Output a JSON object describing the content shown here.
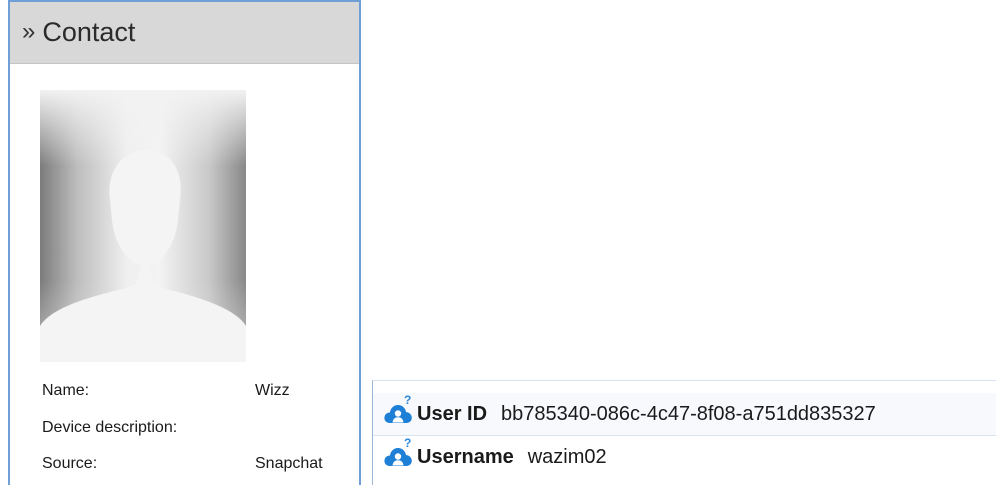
{
  "contact": {
    "title": "Contact",
    "fields": [
      {
        "label": "Name:",
        "value": "Wizz"
      },
      {
        "label": "Device description:",
        "value": ""
      },
      {
        "label": "Source:",
        "value": "Snapchat"
      }
    ]
  },
  "details": {
    "rows": [
      {
        "label": "User ID",
        "value": "bb785340-086c-4c47-8f08-a751dd835327",
        "icon": "cloud-user-icon"
      },
      {
        "label": "Username",
        "value": "wazim02",
        "icon": "cloud-user-icon"
      }
    ]
  },
  "colors": {
    "header_bg": "#d8d8d8",
    "panel_border": "#6f9fd6",
    "icon_blue": "#1e7fd6"
  }
}
